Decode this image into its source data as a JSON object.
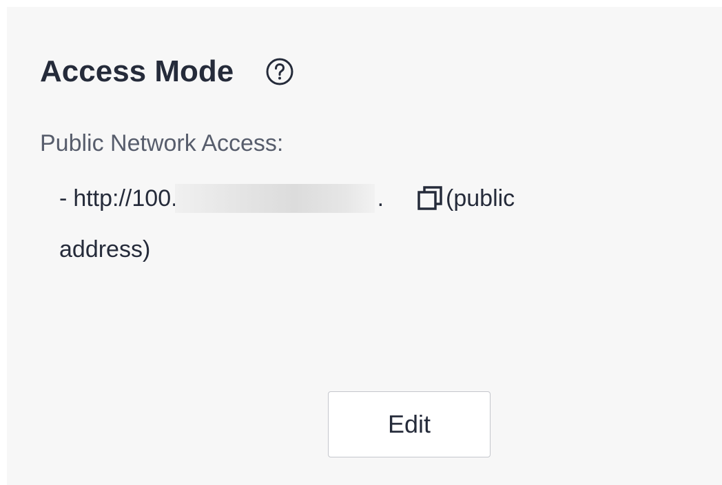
{
  "access_mode": {
    "title": "Access Mode",
    "help_icon": "question-circle-icon",
    "public_network_label": "Public Network Access:",
    "address": {
      "dash": "-",
      "prefix": "http://100.",
      "redacted": true,
      "suffix": ".",
      "copy_icon": "copy-icon",
      "note_line1": "(public",
      "note_line2": "address)"
    },
    "edit_label": "Edit"
  },
  "colors": {
    "panel_bg": "#f7f7f7",
    "title": "#252b3a",
    "label": "#575d6c",
    "button_border": "#c4c6cc"
  }
}
